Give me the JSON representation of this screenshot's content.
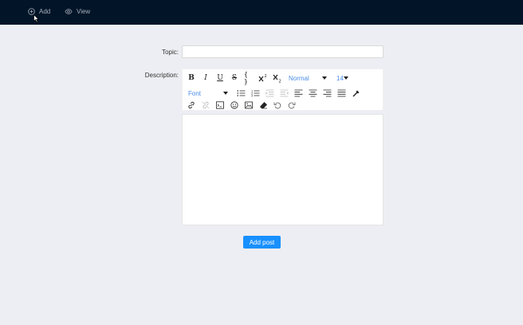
{
  "nav": {
    "add_label": "Add",
    "view_label": "View"
  },
  "form": {
    "topic_label": "Topic:",
    "topic_value": "",
    "description_label": "Description:",
    "submit_label": "Add post"
  },
  "toolbar": {
    "bold": "B",
    "italic": "I",
    "underline": "U",
    "strikethrough": "S",
    "code": "{ }",
    "block_type": "Normal",
    "font_size": "14",
    "font_family": "Font",
    "icons": [
      "bold-icon",
      "italic-icon",
      "underline-icon",
      "strikethrough-icon",
      "code-icon",
      "superscript-icon",
      "subscript-icon",
      "color-picker-icon",
      "unordered-list-icon",
      "ordered-list-icon",
      "indent-icon",
      "outdent-icon",
      "align-left-icon",
      "align-center-icon",
      "align-right-icon",
      "align-justify-icon",
      "link-icon",
      "unlink-icon",
      "embedded-icon",
      "emoji-icon",
      "image-icon",
      "eraser-icon",
      "undo-icon",
      "redo-icon"
    ]
  },
  "colors": {
    "topbar": "#021428",
    "accent": "#1890ff",
    "dropdown_text": "#4b8de8",
    "background": "#edeef3"
  }
}
